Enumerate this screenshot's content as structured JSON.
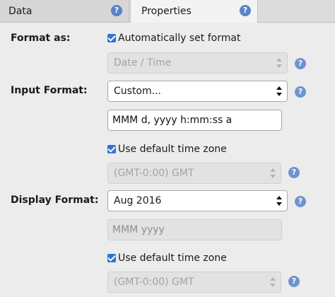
{
  "tabs": [
    {
      "label": "Data"
    },
    {
      "label": "Properties"
    }
  ],
  "format_as": {
    "label": "Format as:",
    "auto_checkbox_label": "Automatically set format",
    "type_select_value": "Date / Time"
  },
  "input_format": {
    "label": "Input Format:",
    "select_value": "Custom...",
    "pattern_value": "MMM d, yyyy h:mm:ss a",
    "tz_checkbox_label": "Use default time zone",
    "tz_select_value": "(GMT-0:00) GMT"
  },
  "display_format": {
    "label": "Display Format:",
    "select_value": "Aug 2016",
    "pattern_value": "MMM yyyy",
    "tz_checkbox_label": "Use default time zone",
    "tz_select_value": "(GMT-0:00) GMT"
  },
  "colors": {
    "accent": "#2f73d8",
    "help": "#5a82c8",
    "panel": "#ececec"
  }
}
